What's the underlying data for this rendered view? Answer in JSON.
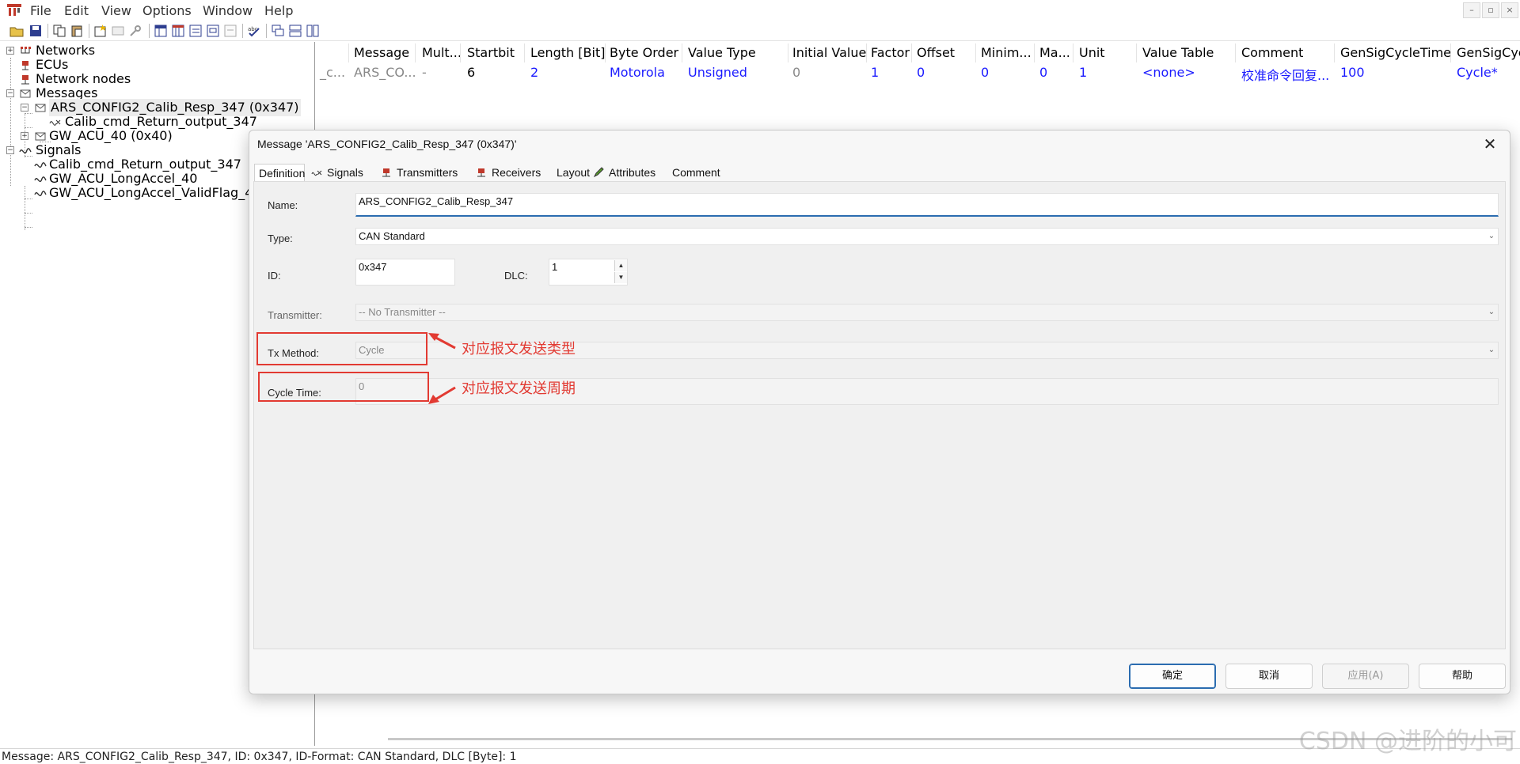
{
  "menubar": {
    "items": [
      "File",
      "Edit",
      "View",
      "Options",
      "Window",
      "Help"
    ],
    "window_controls": [
      "–",
      "▫",
      "×"
    ]
  },
  "tree": {
    "networks": "Networks",
    "ecus": "ECUs",
    "network_nodes": "Network nodes",
    "messages": "Messages",
    "message_1": "ARS_CONFIG2_Calib_Resp_347 (0x347)",
    "message_1_signal": "Calib_cmd_Return_output_347",
    "message_2": "GW_ACU_40 (0x40)",
    "signals": "Signals",
    "signal_1": "Calib_cmd_Return_output_347",
    "signal_2": "GW_ACU_LongAccel_40",
    "signal_3": "GW_ACU_LongAccel_ValidFlag_40"
  },
  "grid": {
    "headers": [
      "Message",
      "Mult...",
      "Startbit",
      "Length [Bit]",
      "Byte Order",
      "Value Type",
      "Initial Value",
      "Factor",
      "Offset",
      "Minim...",
      "Ma...",
      "Unit",
      "Value Table",
      "Comment",
      "GenSigCycleTime",
      "GenSigCyc"
    ],
    "row": {
      "name_clip": "_c...",
      "cells": [
        "ARS_CO...",
        "-",
        "6",
        "2",
        "Motorola",
        "Unsigned",
        "0",
        "1",
        "0",
        "0",
        "0",
        "1",
        "<none>",
        "校准命令回复...",
        "100",
        "Cycle*"
      ]
    }
  },
  "dialog": {
    "title": "Message 'ARS_CONFIG2_Calib_Resp_347 (0x347)'",
    "close": "✕",
    "tabs": [
      "Definition",
      "Signals",
      "Transmitters",
      "Receivers",
      "Layout",
      "Attributes",
      "Comment"
    ],
    "fields": {
      "name_label": "Name:",
      "name_value": "ARS_CONFIG2_Calib_Resp_347",
      "type_label": "Type:",
      "type_value": "CAN Standard",
      "id_label": "ID:",
      "id_value": "0x347",
      "dlc_label": "DLC:",
      "dlc_value": "1",
      "transmitter_label": "Transmitter:",
      "transmitter_value": "-- No Transmitter --",
      "tx_method_label": "Tx Method:",
      "tx_method_value": "Cycle",
      "cycle_time_label": "Cycle Time:",
      "cycle_time_value": "0"
    },
    "annotations": {
      "tx_method_note": "对应报文发送类型",
      "cycle_time_note": "对应报文发送周期"
    },
    "buttons": {
      "ok": "确定",
      "cancel": "取消",
      "apply": "应用(A)",
      "help": "帮助"
    }
  },
  "statusbar": {
    "text": "Message: ARS_CONFIG2_Calib_Resp_347,    ID: 0x347,    ID-Format: CAN Standard,    DLC [Byte]: 1"
  },
  "watermark": "CSDN @进阶的小可",
  "colors": {
    "accent_red": "#e23a32",
    "grid_value_blue": "#1a1aff",
    "focus_blue": "#2b6cb0"
  }
}
